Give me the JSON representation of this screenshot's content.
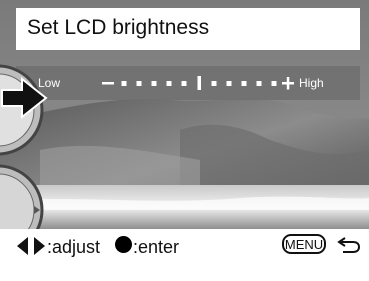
{
  "title": "Set LCD brightness",
  "slider": {
    "low_label": "Low",
    "high_label": "High",
    "minus_symbol": "–",
    "plus_symbol": "+",
    "steps": 11,
    "current_step": 5
  },
  "footer": {
    "adjust_label": ":adjust",
    "enter_label": ":enter",
    "menu_label": "MENU"
  },
  "icons": {
    "adjust": "left-right-arrows-icon",
    "enter": "filled-circle-icon",
    "back": "return-arrow-icon",
    "pointer": "right-arrow-icon"
  },
  "colors": {
    "bar_white": "#ffffff",
    "slider_bg": "#6e6e6e",
    "text_dark": "#111111"
  }
}
